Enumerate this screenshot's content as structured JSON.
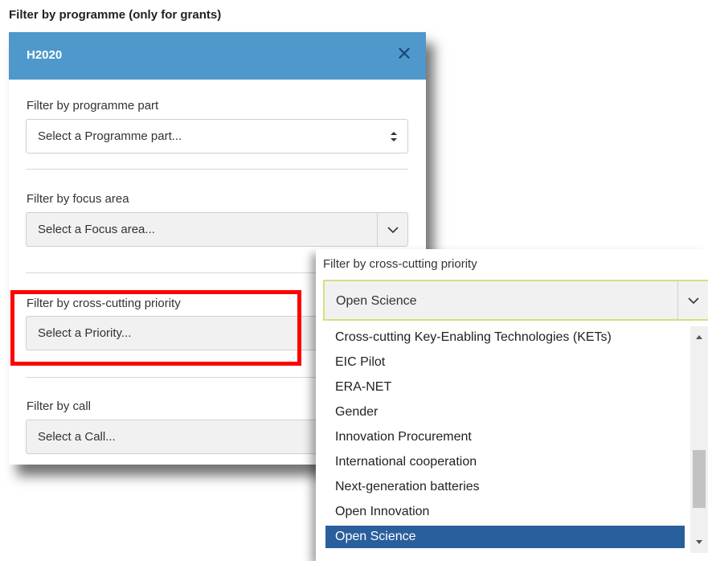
{
  "filter_programme": {
    "heading": "Filter by programme (only for grants)",
    "selected": "H2020",
    "close_glyph": "✕",
    "programme_part": {
      "label": "Filter by programme part",
      "placeholder": "Select a Programme part..."
    },
    "focus_area": {
      "label": "Filter by focus area",
      "placeholder": "Select a Focus area..."
    },
    "priority": {
      "label": "Filter by cross-cutting priority",
      "placeholder": "Select a Priority..."
    },
    "call": {
      "label": "Filter by call",
      "placeholder": "Select a Call..."
    }
  },
  "priority_dropdown": {
    "label": "Filter by cross-cutting priority",
    "selected": "Open Science",
    "options": [
      "Cross-cutting Key-Enabling Technologies (KETs)",
      "EIC Pilot",
      "ERA-NET",
      "Gender",
      "Innovation Procurement",
      "International cooperation",
      "Next-generation batteries",
      "Open Innovation",
      "Open Science"
    ],
    "highlighted_index": 8
  },
  "colors": {
    "header_bg": "#4f98cb",
    "highlight_bg": "#2a5f9e",
    "annotation_red": "#ff0000"
  },
  "icons": {
    "close": "close-icon",
    "sort": "sort-arrows-icon",
    "chevron": "chevron-down-icon"
  }
}
